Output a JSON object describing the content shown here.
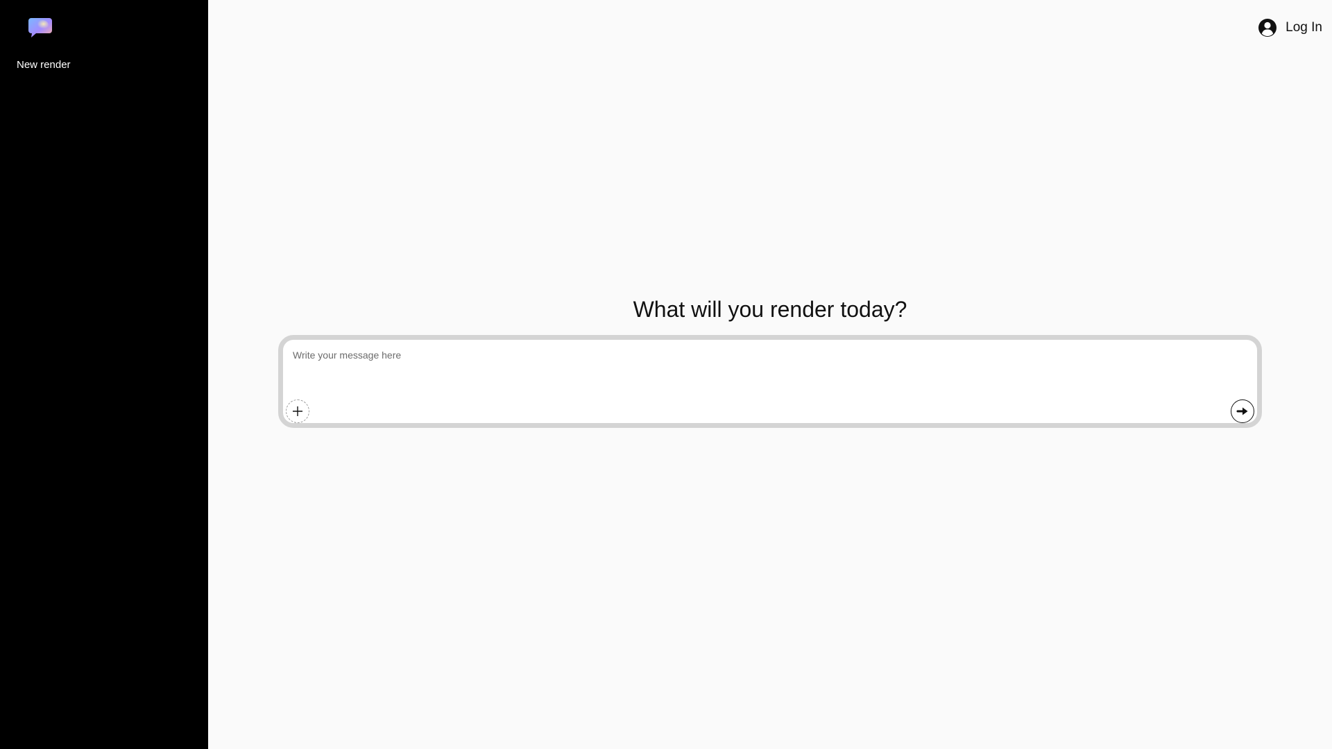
{
  "sidebar": {
    "logo_icon": "chat-bubble-gradient-icon",
    "new_render_label": "New render"
  },
  "header": {
    "user_icon": "user-circle-icon",
    "login_label": "Log In"
  },
  "main": {
    "heading": "What will you render today?",
    "composer": {
      "value": "",
      "placeholder": "Write your message here",
      "attach_icon": "plus-icon",
      "send_icon": "arrow-right-icon"
    }
  },
  "colors": {
    "sidebar_bg": "#000000",
    "main_bg": "#fafafa",
    "composer_border": "#d4d4d4"
  }
}
